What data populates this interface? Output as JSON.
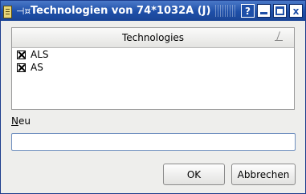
{
  "window": {
    "title": "Technologien von 74*1032A (J)",
    "icon": "document-icon",
    "pin_glyph": "⊣¤",
    "buttons": {
      "help": "?",
      "close": "x"
    }
  },
  "list": {
    "header": "Technologies",
    "items": [
      {
        "label": "ALS",
        "checked": true
      },
      {
        "label": "AS",
        "checked": true
      }
    ]
  },
  "new_field": {
    "label_underlined": "N",
    "label_rest": "eu",
    "value": ""
  },
  "buttons": {
    "ok": "OK",
    "cancel": "Abbrechen"
  }
}
